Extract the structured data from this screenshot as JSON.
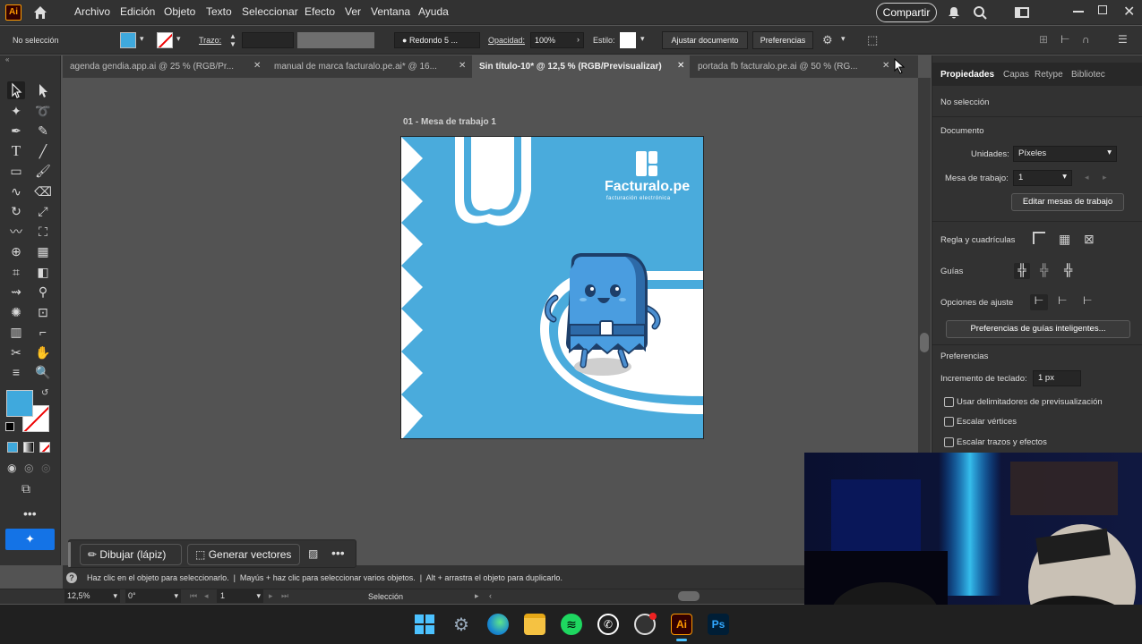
{
  "menubar": {
    "app_logo": "Ai",
    "items": [
      "Archivo",
      "Edición",
      "Objeto",
      "Texto",
      "Seleccionar",
      "Efecto",
      "Ver",
      "Ventana",
      "Ayuda"
    ],
    "share_label": "Compartir"
  },
  "controlbar": {
    "selection_state": "No selección",
    "stroke_label": "Trazo:",
    "brush_label": "Redondo 5 ...",
    "opacity_label": "Opacidad:",
    "opacity_value": "100%",
    "style_label": "Estilo:",
    "fit_doc_button": "Ajustar documento",
    "prefs_button": "Preferencias",
    "fill_color": "#3fa9dd"
  },
  "tabs": [
    {
      "label": "agenda gendia.app.ai @ 25 % (RGB/Pr..."
    },
    {
      "label": "manual de marca facturalo.pe.ai* @ 16..."
    },
    {
      "label": "Sin título-10* @ 12,5 % (RGB/Previsualizar)"
    },
    {
      "label": "portada fb facturalo.pe.ai @ 50 % (RG..."
    }
  ],
  "artboard": {
    "name": "01 - Mesa de trabajo 1",
    "brand_name": "Facturalo.pe",
    "brand_tagline": "facturación electrónica",
    "bg_color": "#4aabdc"
  },
  "rightpanel": {
    "tabs": [
      "Propiedades",
      "Capas",
      "Retype",
      "Bibliotec"
    ],
    "no_selection": "No selección",
    "document_title": "Documento",
    "units_label": "Unidades:",
    "units_value": "Píxeles",
    "artboard_label": "Mesa de trabajo:",
    "artboard_value": "1",
    "edit_artboards_button": "Editar mesas de trabajo",
    "rulers_label": "Regla y cuadrículas",
    "guides_label": "Guías",
    "snap_label": "Opciones de ajuste",
    "smart_guides_button": "Preferencias de guías inteligentes...",
    "prefs_title": "Preferencias",
    "keyboard_inc_label": "Incremento de teclado:",
    "keyboard_inc_value": "1 px",
    "checkboxes": [
      "Usar delimitadores de previsualización",
      "Escalar vértices",
      "Escalar trazos y efectos"
    ]
  },
  "floatbar": {
    "draw_button": "Dibujar (lápiz)",
    "generate_button": "Generar vectores"
  },
  "hint": {
    "text": "Haz clic en el objeto para seleccionarlo.  |  Mayús + haz clic para seleccionar varios objetos.  |  Alt + arrastra el objeto para duplicarlo."
  },
  "statusbar": {
    "zoom": "12,5%",
    "rotation": "0°",
    "artboard_num": "1",
    "tool_name": "Selección"
  },
  "taskbar": {
    "apps": [
      "windows",
      "settings",
      "edge",
      "explorer",
      "spotify",
      "whatsapp",
      "obs",
      "illustrator",
      "photoshop"
    ]
  }
}
